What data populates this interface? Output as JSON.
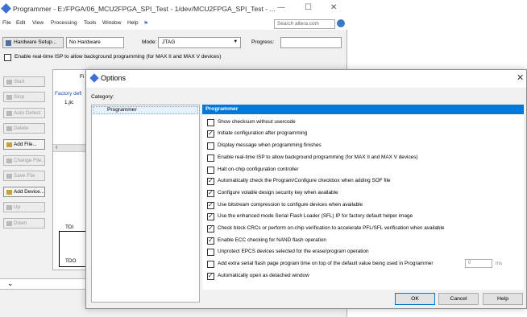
{
  "programmer_window": {
    "title": "Programmer - E:/FPGA/06_MCU2FPGA_SPI_Test - 1/dev/MCU2FPGA_SPI_Test - ...",
    "controls": {
      "minimize": "—",
      "maximize": "☐",
      "close": "✕"
    },
    "menu": [
      "File",
      "Edit",
      "View",
      "Processing",
      "Tools",
      "Window",
      "Help"
    ],
    "search_placeholder": "Search altera.com",
    "hardware_setup_label": "Hardware Setup...",
    "hardware_value": "No Hardware",
    "mode_label": "Mode:",
    "mode_value": "JTAG",
    "progress_label": "Progress:",
    "realtime_isp_label": "Enable real-time ISP to allow background programming (for MAX II and MAX V devices)",
    "side_buttons": [
      {
        "label": "Start",
        "enabled": false
      },
      {
        "label": "Stop",
        "enabled": false
      },
      {
        "label": "Auto Detect",
        "enabled": false
      },
      {
        "label": "Delete",
        "enabled": false
      },
      {
        "label": "Add File...",
        "enabled": true
      },
      {
        "label": "Change File...",
        "enabled": false
      },
      {
        "label": "Save File",
        "enabled": false
      },
      {
        "label": "Add Device...",
        "enabled": true
      },
      {
        "label": "Up",
        "enabled": false
      },
      {
        "label": "Down",
        "enabled": false
      }
    ],
    "chain": {
      "column_header": "Fi",
      "factory_text": "Factory defi",
      "file_text": "1.jic",
      "tdi": "TDI",
      "tdo": "TDO"
    }
  },
  "options_dialog": {
    "title": "Options",
    "close": "✕",
    "category_label": "Category:",
    "categories": [
      "Programmer"
    ],
    "panel_header": "Programmer",
    "options": [
      {
        "label": "Show checksum without usercode",
        "checked": false
      },
      {
        "label": "Initiate configuration after programming",
        "checked": true
      },
      {
        "label": "Display message when programming finishes",
        "checked": false
      },
      {
        "label": "Enable real-time ISP to allow background programming (for MAX II and MAX V devices)",
        "checked": false
      },
      {
        "label": "Halt on-chip configuration controller",
        "checked": false
      },
      {
        "label": "Automatically check the Program/Configure checkbox when adding SOF file",
        "checked": true
      },
      {
        "label": "Configure volatile design security key when available",
        "checked": true
      },
      {
        "label": "Use bitstream compression to configure devices when available",
        "checked": true
      },
      {
        "label": "Use the enhanced mode Serial Flash Loader (SFL) IP for factory default helper image",
        "checked": true
      },
      {
        "label": "Check block CRCs or perform on-chip verification to accelerate PFL/SFL verification when available",
        "checked": true
      },
      {
        "label": "Enable ECC checking for NAND flash operation",
        "checked": true
      },
      {
        "label": "Unprotect EPCS devices selected for the erase/program operation",
        "checked": false
      },
      {
        "label": "Add extra serial flash page program time on top of the default value being used in Programmer",
        "checked": false
      },
      {
        "label": "Automatically open as detached window",
        "checked": true
      }
    ],
    "extra_time_value": "0",
    "extra_time_unit": "ms",
    "buttons": {
      "ok": "OK",
      "cancel": "Cancel",
      "help": "Help"
    }
  }
}
